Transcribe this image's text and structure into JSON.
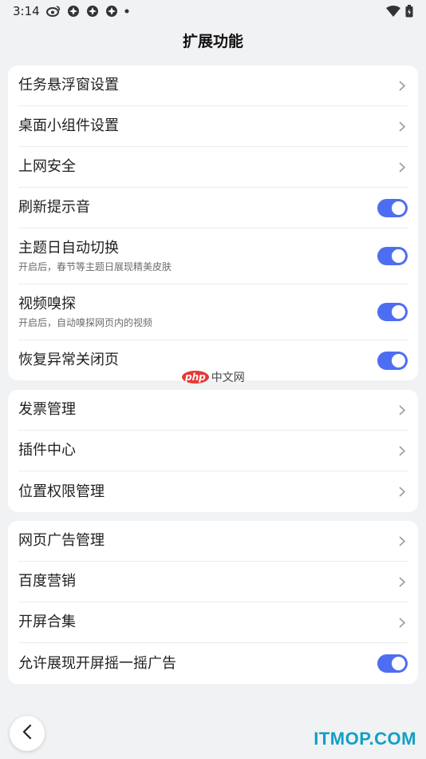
{
  "status_bar": {
    "time": "3:14",
    "icons": [
      "weibo-icon",
      "app-icon",
      "app-icon",
      "app-icon",
      "dot-icon"
    ],
    "right_icons": [
      "wifi-icon",
      "battery-icon"
    ]
  },
  "header": {
    "title": "扩展功能"
  },
  "groups": [
    {
      "items": [
        {
          "label": "任务悬浮窗设置",
          "control": "chevron"
        },
        {
          "label": "桌面小组件设置",
          "control": "chevron"
        },
        {
          "label": "上网安全",
          "control": "chevron"
        },
        {
          "label": "刷新提示音",
          "control": "toggle",
          "on": true
        },
        {
          "label": "主题日自动切换",
          "sub": "开启后，春节等主题日展现精美皮肤",
          "control": "toggle",
          "on": true
        },
        {
          "label": "视频嗅探",
          "sub": "开启后，自动嗅探网页内的视频",
          "control": "toggle",
          "on": true
        },
        {
          "label": "恢复异常关闭页",
          "control": "toggle",
          "on": true
        }
      ]
    },
    {
      "items": [
        {
          "label": "发票管理",
          "control": "chevron"
        },
        {
          "label": "插件中心",
          "control": "chevron"
        },
        {
          "label": "位置权限管理",
          "control": "chevron"
        }
      ]
    },
    {
      "items": [
        {
          "label": "网页广告管理",
          "control": "chevron"
        },
        {
          "label": "百度营销",
          "control": "chevron"
        },
        {
          "label": "开屏合集",
          "control": "chevron"
        },
        {
          "label": "允许展现开屏摇一摇广告",
          "control": "toggle",
          "on": true
        }
      ]
    }
  ],
  "watermark": {
    "logo": "php",
    "text": "中文网"
  },
  "brand": {
    "text": "ITMOP.COM"
  },
  "colors": {
    "accent": "#4e6ef2",
    "background": "#f1f2f4",
    "card": "#ffffff",
    "brand": "#10a0c6"
  }
}
